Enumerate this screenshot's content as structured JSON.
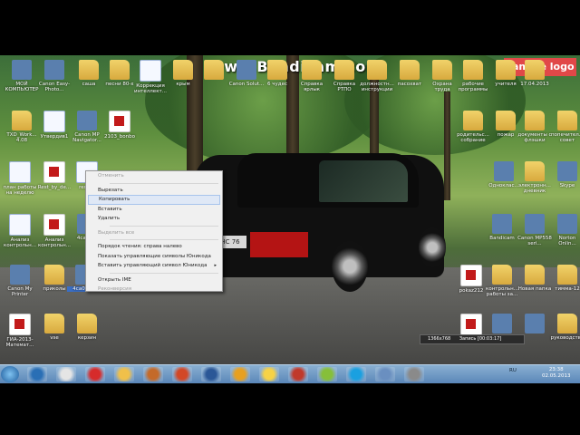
{
  "watermark": "www.Bandicam.com",
  "sample_badge": "sample logo",
  "car_plate": "НС 76",
  "desktop_icons": [
    {
      "label": "МОЙ КОМПЬЮТЕР",
      "type": "app"
    },
    {
      "label": "Canon Easy-Photo...",
      "type": "app"
    },
    {
      "label": "саша",
      "type": "folder"
    },
    {
      "label": "песни 80-х",
      "type": "folder"
    },
    {
      "label": "Коррекция интеллект...",
      "type": "doc"
    },
    {
      "label": "крым",
      "type": "folder"
    },
    {
      "label": "",
      "type": "folder"
    },
    {
      "label": "Canon Solut...",
      "type": "app"
    },
    {
      "label": "6 чудес",
      "type": "folder"
    },
    {
      "label": "Справка ярлык",
      "type": "folder"
    },
    {
      "label": "Справка РТПО",
      "type": "folder"
    },
    {
      "label": "должностн... инструкции",
      "type": "folder"
    },
    {
      "label": "пасохват",
      "type": "folder"
    },
    {
      "label": "Охрана труда",
      "type": "folder"
    },
    {
      "label": "рабочие программы",
      "type": "folder"
    },
    {
      "label": "учителя",
      "type": "folder"
    },
    {
      "label": "17.04.2013",
      "type": "folder"
    },
    {
      "label": "TXD_Work... 4.08",
      "type": "folder"
    },
    {
      "label": "Утвердив1",
      "type": "doc"
    },
    {
      "label": "Canon MP Navigator...",
      "type": "app"
    },
    {
      "label": "2103_bonbo",
      "type": "pdf"
    },
    {
      "label": "родительс... собрание",
      "type": "folder"
    },
    {
      "label": "пожар",
      "type": "folder"
    },
    {
      "label": "документы с флэшки",
      "type": "folder"
    },
    {
      "label": "попечител... совет",
      "type": "folder"
    },
    {
      "label": "план работы на неделю",
      "type": "doc"
    },
    {
      "label": "Rest_by_de...",
      "type": "pdf"
    },
    {
      "label": "rest-...",
      "type": "doc"
    },
    {
      "label": "Одноклас...",
      "type": "app"
    },
    {
      "label": "электронн... дневник",
      "type": "folder"
    },
    {
      "label": "Skype",
      "type": "app"
    },
    {
      "label": "Анализ контрольн...",
      "type": "doc"
    },
    {
      "label": "Анализ контрольн...",
      "type": "pdf"
    },
    {
      "label": "4са02...",
      "type": "app"
    },
    {
      "label": "Bandicam",
      "type": "app"
    },
    {
      "label": "Canon MP558 seri...",
      "type": "app"
    },
    {
      "label": "Norton Onlin...",
      "type": "app"
    },
    {
      "label": "Canon My Printer",
      "type": "app"
    },
    {
      "label": "приколы",
      "type": "folder"
    },
    {
      "label": "4ca02pr...",
      "type": "app",
      "selected": true
    },
    {
      "label": "pokaz212",
      "type": "pdf"
    },
    {
      "label": "контрольн... работы за...",
      "type": "folder"
    },
    {
      "label": "Новая папка",
      "type": "folder"
    },
    {
      "label": "тимма-12",
      "type": "folder"
    },
    {
      "label": "ГИА-2013-Математ...",
      "type": "pdf"
    },
    {
      "label": "vse",
      "type": "folder"
    },
    {
      "label": "керзин",
      "type": "folder"
    },
    {
      "label": "",
      "type": "pdf"
    },
    {
      "label": "",
      "type": "app"
    },
    {
      "label": "",
      "type": "app"
    },
    {
      "label": "руководство",
      "type": "folder"
    }
  ],
  "context_menu": [
    {
      "label": "Отменить",
      "disabled": true
    },
    {
      "separator": true
    },
    {
      "label": "Вырезать"
    },
    {
      "label": "Копировать",
      "hover": true
    },
    {
      "label": "Вставить"
    },
    {
      "label": "Удалить"
    },
    {
      "separator": true
    },
    {
      "label": "Выделить все",
      "disabled": true
    },
    {
      "separator": true
    },
    {
      "label": "Порядок чтения: справа налево"
    },
    {
      "label": "Показать управляющие символы Юникода"
    },
    {
      "label": "Вставить управляющий символ Юникода",
      "submenu": true
    },
    {
      "separator": true
    },
    {
      "label": "Открыть IME"
    },
    {
      "label": "Реконверсия",
      "disabled": true
    }
  ],
  "recording_bar": {
    "resolution": "1366x768",
    "status": "Запись [00:03:17]"
  },
  "taskbar": {
    "buttons": [
      "windows-explorer",
      "chrome",
      "yandex",
      "folder",
      "tool",
      "powerpoint",
      "word",
      "media",
      "mail",
      "game",
      "leaf",
      "skype",
      "app1",
      "app2"
    ],
    "tray_lang": "RU",
    "time": "23:38",
    "date": "02.05.2013"
  },
  "colors": {
    "taskbar": "#5a86b8",
    "selection": "#3a6ec4",
    "menu_bg": "#f0f0f0",
    "badge": "#e14848"
  }
}
